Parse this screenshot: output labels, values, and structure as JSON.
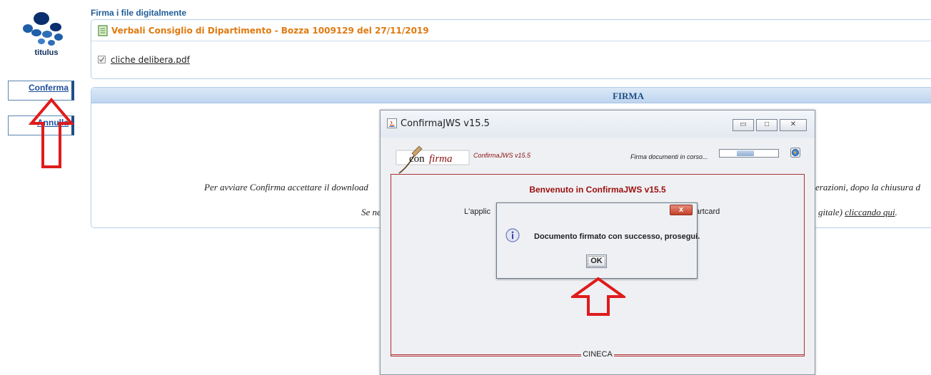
{
  "logo": {
    "label": "titulus"
  },
  "sidebar": {
    "confirm_label": "Conferma",
    "cancel_label": "Annulla"
  },
  "header": {
    "heading": "Firma i file digitalmente",
    "document_title": "Verbali Consiglio di Dipartimento - Bozza 1009129 del 27/11/2019",
    "file_name": "cliche delibera.pdf"
  },
  "firma": {
    "title": "FIRMA",
    "line1_left": "Per avviare Confirma accettare il download",
    "line1_right": "erazioni, dopo la chiusura d",
    "line2_left": "Se ne",
    "line2_right": "gitale)",
    "line2_link": "cliccando qui",
    "line2_end": "."
  },
  "java_window": {
    "title": "ConfirmaJWS v15.5",
    "app_version": "ConfirmaJWS v15.5",
    "status": "Firma documenti in corso...",
    "progress": 0.3,
    "logo_text_con": "con",
    "logo_text_firma": "firma",
    "welcome": "Benvenuto in ConfirmaJWS v15.5",
    "body_left": "L'applic",
    "body_right": "artcard",
    "footer": "CINECA"
  },
  "dialog": {
    "message": "Documento firmato con successo, prosegui.",
    "ok_label": "OK",
    "close_label": "x"
  },
  "colors": {
    "accent": "#1f4e84",
    "title_orange": "#e07a10",
    "annotation_red": "#e01b1b"
  }
}
